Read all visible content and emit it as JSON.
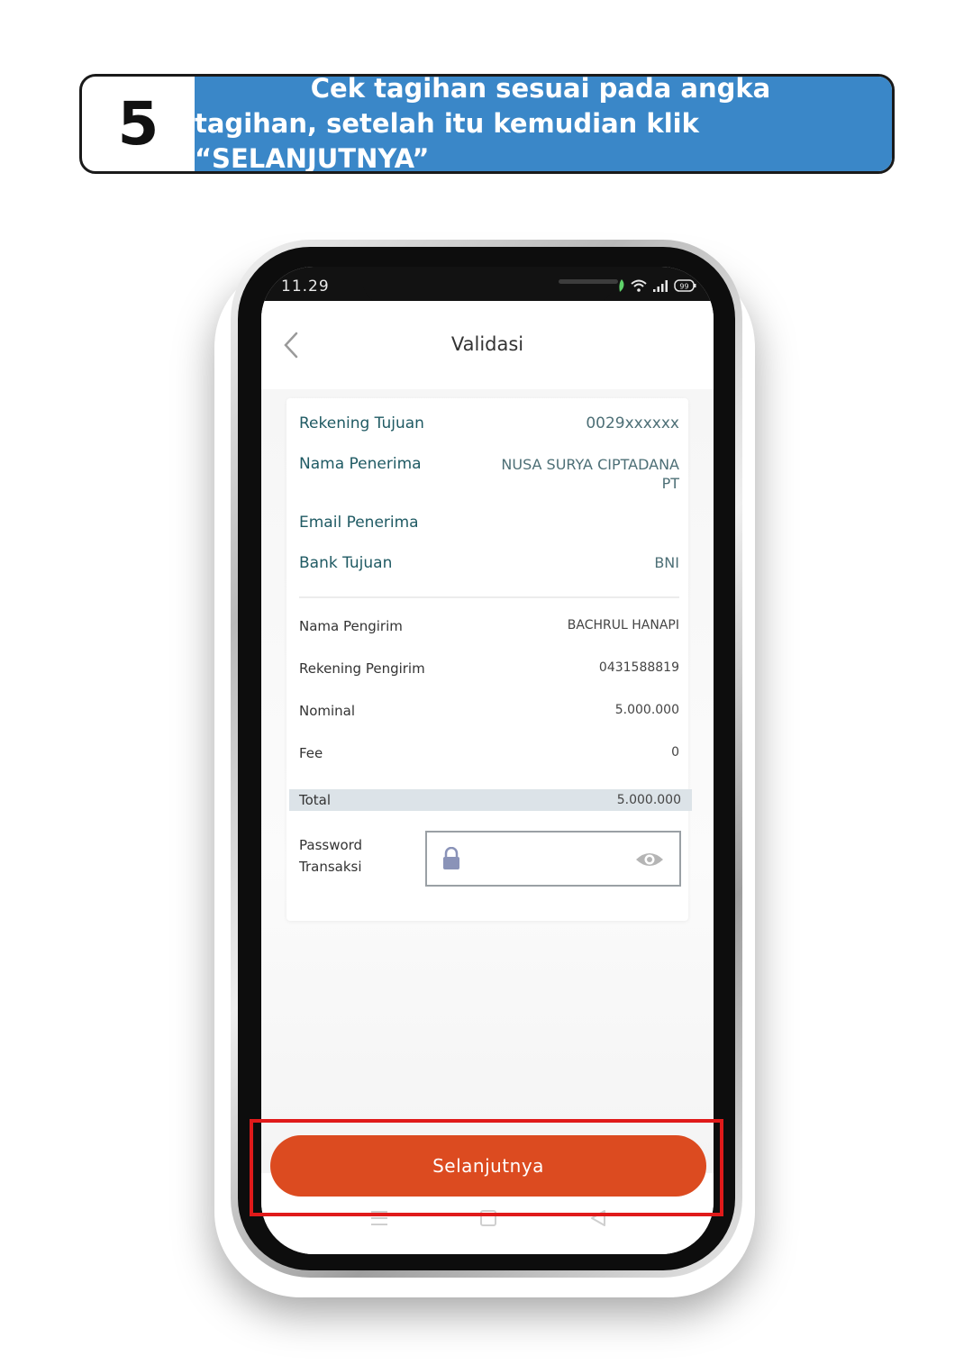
{
  "step": {
    "number": "5",
    "line1": "Cek tagihan sesuai pada angka",
    "line2": "tagihan, setelah itu kemudian klik “SELANJUTNYA”"
  },
  "status_bar": {
    "time": "11.29",
    "battery": "99"
  },
  "appbar": {
    "title": "Validasi"
  },
  "recipient": {
    "rekening_label": "Rekening Tujuan",
    "rekening_value": "0029xxxxxx",
    "nama_label": "Nama Penerima",
    "nama_value_1": "NUSA SURYA CIPTADANA",
    "nama_value_2": "PT",
    "email_label": "Email Penerima",
    "bank_label": "Bank Tujuan",
    "bank_value": "BNI"
  },
  "sender": {
    "nama_label": "Nama Pengirim",
    "nama_value": "BACHRUL HANAPI",
    "rekening_label": "Rekening Pengirim",
    "rekening_value": "0431588819",
    "nominal_label": "Nominal",
    "nominal_value": "5.000.000",
    "fee_label": "Fee",
    "fee_value": "0",
    "total_label": "Total",
    "total_value": "5.000.000"
  },
  "password": {
    "label_1": "Password",
    "label_2": "Transaksi",
    "value": ""
  },
  "next_button": {
    "label": "Selanjutnya"
  },
  "colors": {
    "header_blue": "#3a87c8",
    "button_orange": "#dc4b20",
    "highlight_red": "#e01a1a"
  }
}
